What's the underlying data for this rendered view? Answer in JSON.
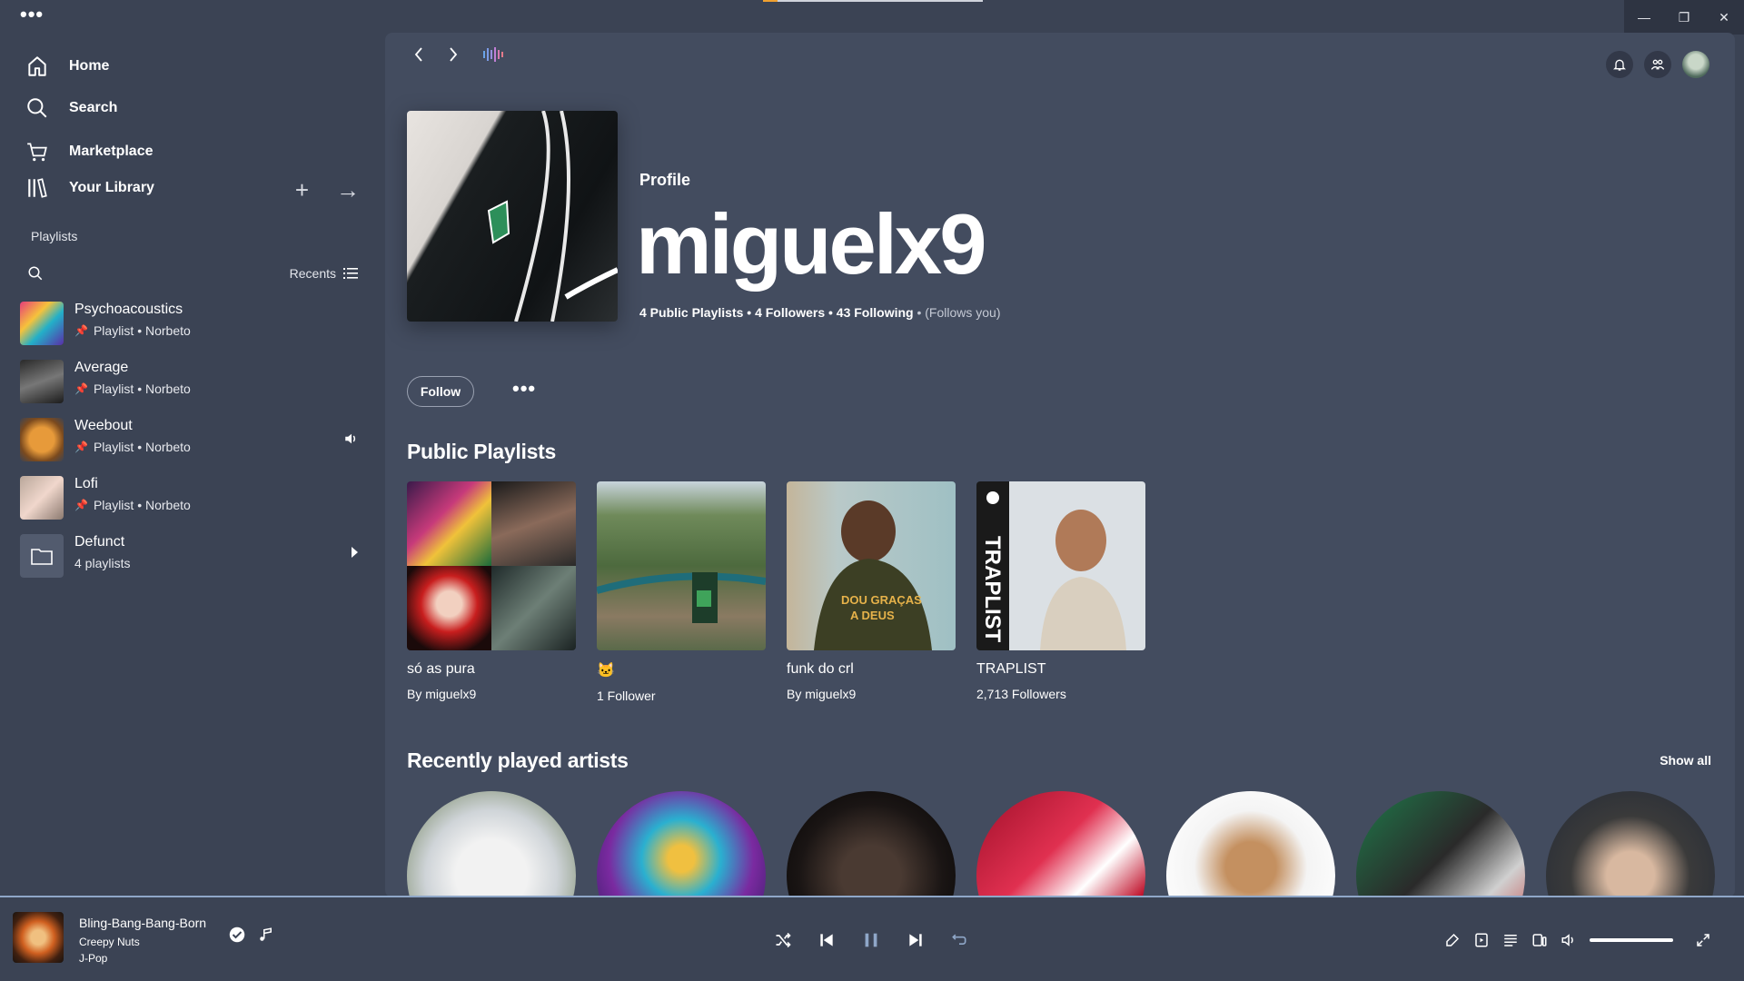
{
  "window": {
    "menu": "•••",
    "minimize": "—",
    "restore": "❐",
    "close": "✕"
  },
  "sidebar": {
    "nav": {
      "home": "Home",
      "search": "Search",
      "marketplace": "Marketplace",
      "library": "Your Library"
    },
    "add": "+",
    "expand": "→",
    "filter": "Playlists",
    "sort": "Recents",
    "items": [
      {
        "title": "Psychoacoustics",
        "subtitle": "Playlist • Norbeto"
      },
      {
        "title": "Average",
        "subtitle": "Playlist • Norbeto"
      },
      {
        "title": "Weebout",
        "subtitle": "Playlist • Norbeto"
      },
      {
        "title": "Lofi",
        "subtitle": "Playlist • Norbeto"
      },
      {
        "title": "Defunct",
        "subtitle": "4 playlists"
      }
    ]
  },
  "profile": {
    "label": "Profile",
    "name": "miguelx9",
    "public_playlists": "4 Public Playlists",
    "followers": "4 Followers",
    "following": "43 Following",
    "follows_you": "(Follows you)",
    "follow_label": "Follow",
    "more_label": "•••"
  },
  "sections": {
    "public_playlists": "Public Playlists",
    "recent_artists": "Recently played artists",
    "show_all": "Show all"
  },
  "playlists": [
    {
      "title": "só as pura",
      "sub": "By miguelx9"
    },
    {
      "title": "🐱",
      "sub": "1 Follower"
    },
    {
      "title": "funk do crl",
      "sub": "By miguelx9"
    },
    {
      "title": "TRAPLIST",
      "sub": "2,713 Followers"
    }
  ],
  "player": {
    "title": "Bling-Bang-Bang-Born",
    "artist": "Creepy Nuts",
    "genre": "J-Pop",
    "volume_level": 1.0
  },
  "colors": {
    "background": "#3b4354",
    "main": "#434c5f",
    "accent": "#8fa7c8"
  }
}
